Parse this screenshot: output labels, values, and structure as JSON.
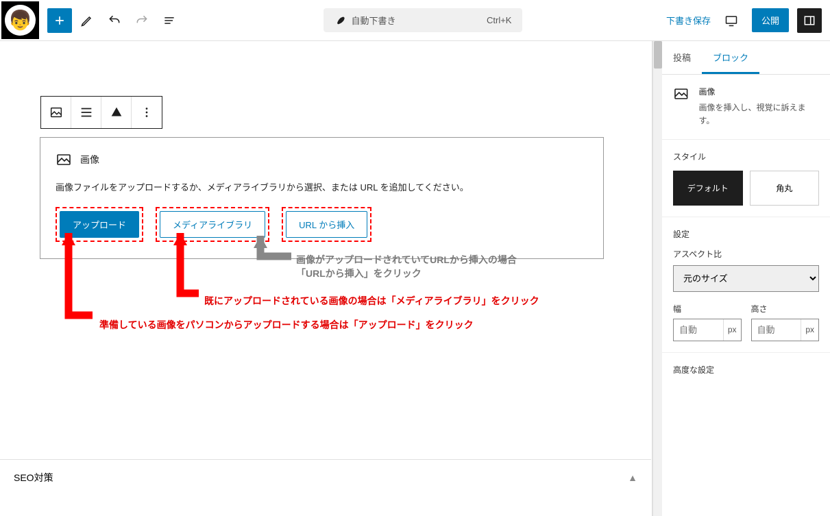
{
  "toolbar": {
    "doc_status": "自動下書き",
    "shortcut": "Ctrl+K",
    "save_draft": "下書き保存",
    "publish": "公開"
  },
  "image_block": {
    "title": "画像",
    "description": "画像ファイルをアップロードするか、メディアライブラリから選択、または URL を追加してください。",
    "btn_upload": "アップロード",
    "btn_media": "メディアライブラリ",
    "btn_url": "URL から挿入"
  },
  "annotations": {
    "url_line1": "画像がアップロードされていてURLから挿入の場合",
    "url_line2": "「URLから挿入」をクリック",
    "media": "既にアップロードされている画像の場合は「メディアライブラリ」をクリック",
    "upload": "準備している画像をパソコンからアップロードする場合は「アップロード」をクリック"
  },
  "sidebar": {
    "tab_post": "投稿",
    "tab_block": "ブロック",
    "block_title": "画像",
    "block_desc": "画像を挿入し、視覚に訴えます。",
    "style_label": "スタイル",
    "style_default": "デフォルト",
    "style_rounded": "角丸",
    "settings_label": "設定",
    "aspect_label": "アスペクト比",
    "aspect_value": "元のサイズ",
    "width_label": "幅",
    "height_label": "高さ",
    "auto": "自動",
    "px": "px",
    "advanced": "高度な設定"
  },
  "footer": {
    "seo": "SEO対策"
  }
}
